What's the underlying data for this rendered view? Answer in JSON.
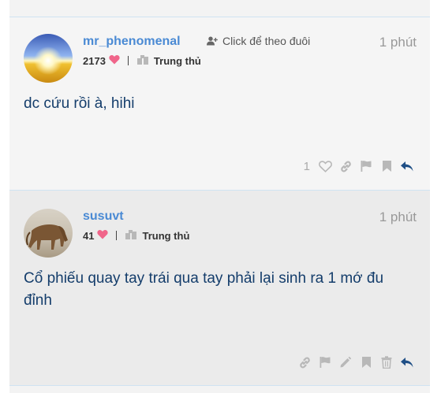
{
  "posts": [
    {
      "username": "mr_phenomenal",
      "likes_count": "2173",
      "title": "Trung thủ",
      "follow_label": "Click để theo đuôi",
      "time": "1 phút",
      "content": "dc cứu rồi à, hihi",
      "post_like_count": "1"
    },
    {
      "username": "susuvt",
      "likes_count": "41",
      "title": "Trung thủ",
      "time": "1 phút",
      "content": "Cổ phiếu quay tay trái qua tay phải lại sinh ra 1 mớ đu đỉnh"
    }
  ],
  "colors": {
    "username": "#4a8ad4",
    "content": "#143d6b",
    "heart": "#f0658a",
    "icon_gray": "#b8b8b8",
    "reply": "#1f4f86"
  },
  "icons": {
    "heart": "heart-icon",
    "title": "book-icon",
    "follow": "user-plus-icon",
    "like": "heart-outline-icon",
    "link": "link-icon",
    "flag": "flag-icon",
    "bookmark": "bookmark-icon",
    "reply": "reply-icon",
    "edit": "pencil-icon",
    "delete": "trash-icon"
  }
}
